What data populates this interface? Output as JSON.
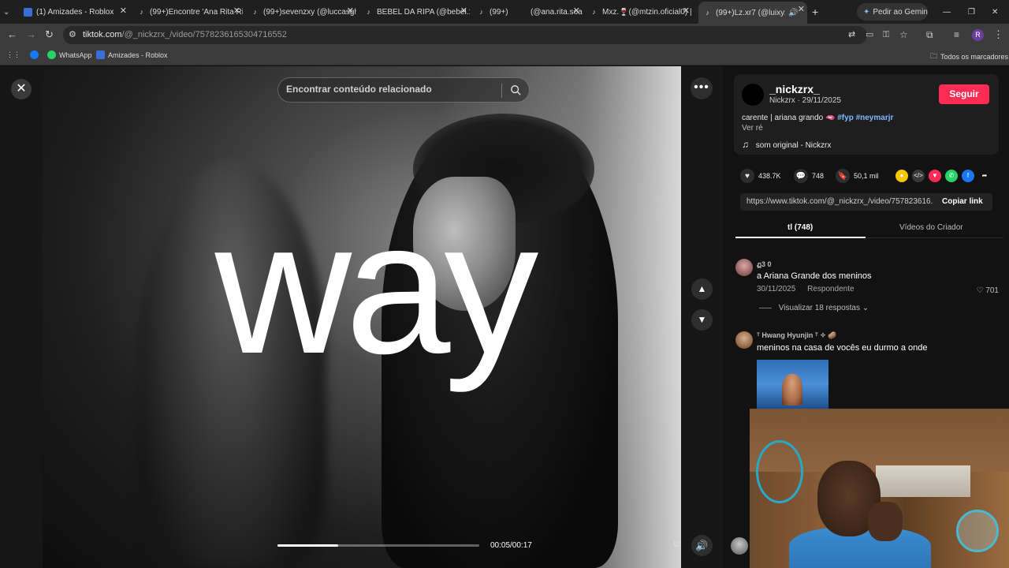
{
  "browser": {
    "tabs": [
      {
        "label": "(1) Amizades - Roblox",
        "favicon_color": "#3b6fd8"
      },
      {
        "label": "(99+)Encontre 'Ana Rita Ri",
        "favicon_color": "#000000"
      },
      {
        "label": "(99+)sevenzxy (@luccasgh",
        "favicon_color": "#000000"
      },
      {
        "label": "BEBEL DA RIPA (@bebel.16",
        "favicon_color": "#000000"
      },
      {
        "label": "(99+)",
        "favicon_color": "#000000"
      },
      {
        "label": "(@ana.rita.soare",
        "favicon_color": "#000000"
      },
      {
        "label": "Mxz.🍷(@mtzin.oficial0) |",
        "favicon_color": "#000000"
      },
      {
        "label": "(99+)Lz.xr7 (@luixyz_n",
        "favicon_color": "#000000"
      }
    ],
    "new_tab": "+",
    "gemini_button": "Pedir ao Gemini",
    "url_host": "tiktok.com",
    "url_path": "/@_nickzrx_/video/7578236165304716552",
    "bookmarks": [
      {
        "label": "",
        "color": "#1877f2"
      },
      {
        "label": "WhatsApp",
        "color": "#25d366"
      },
      {
        "label": "Amizades - Roblox",
        "color": "#3b6fd8"
      }
    ],
    "all_bookmarks": "Todos os marcadores",
    "profile_initial": "R"
  },
  "video": {
    "overlay_word": "way",
    "search_placeholder": "Encontrar conteúdo relacionado",
    "time": "00:05/00:17",
    "progress": 0.3
  },
  "creator": {
    "username": "_nickzrx_",
    "subline": "Nickzrx · 29/11/2025",
    "follow": "Seguir",
    "caption": "carente | ariana grando 🫦",
    "hashtags": [
      "#fyp",
      "#neymarjr"
    ],
    "see_more": "Ver ré",
    "sound": "som original - Nickzrx"
  },
  "stats": {
    "likes": "438.7K",
    "comments": "748",
    "saves": "50,1 mil"
  },
  "share_colors": [
    "#f6c600",
    "#3a3a3a",
    "#fe2c55",
    "#25d366",
    "#1877f2"
  ],
  "link": {
    "url": "https://www.tiktok.com/@_nickzrx_/video/757823616...",
    "copy": "Copiar link"
  },
  "panel_tabs": {
    "comments": "tl (748)",
    "creator_videos": "Vídeos do Criador"
  },
  "comments": [
    {
      "name": "ฏ3 0",
      "text": "a Ariana Grande dos meninos",
      "date": "30/11/2025",
      "reply": "Respondente",
      "likes": "701",
      "replies": "Visualizar 18 respostas"
    },
    {
      "name": "ᵀ Hwang Hyunjin ᵀ ✧ 🥔",
      "text": "meninos na casa de vocês eu durmo a onde"
    }
  ]
}
